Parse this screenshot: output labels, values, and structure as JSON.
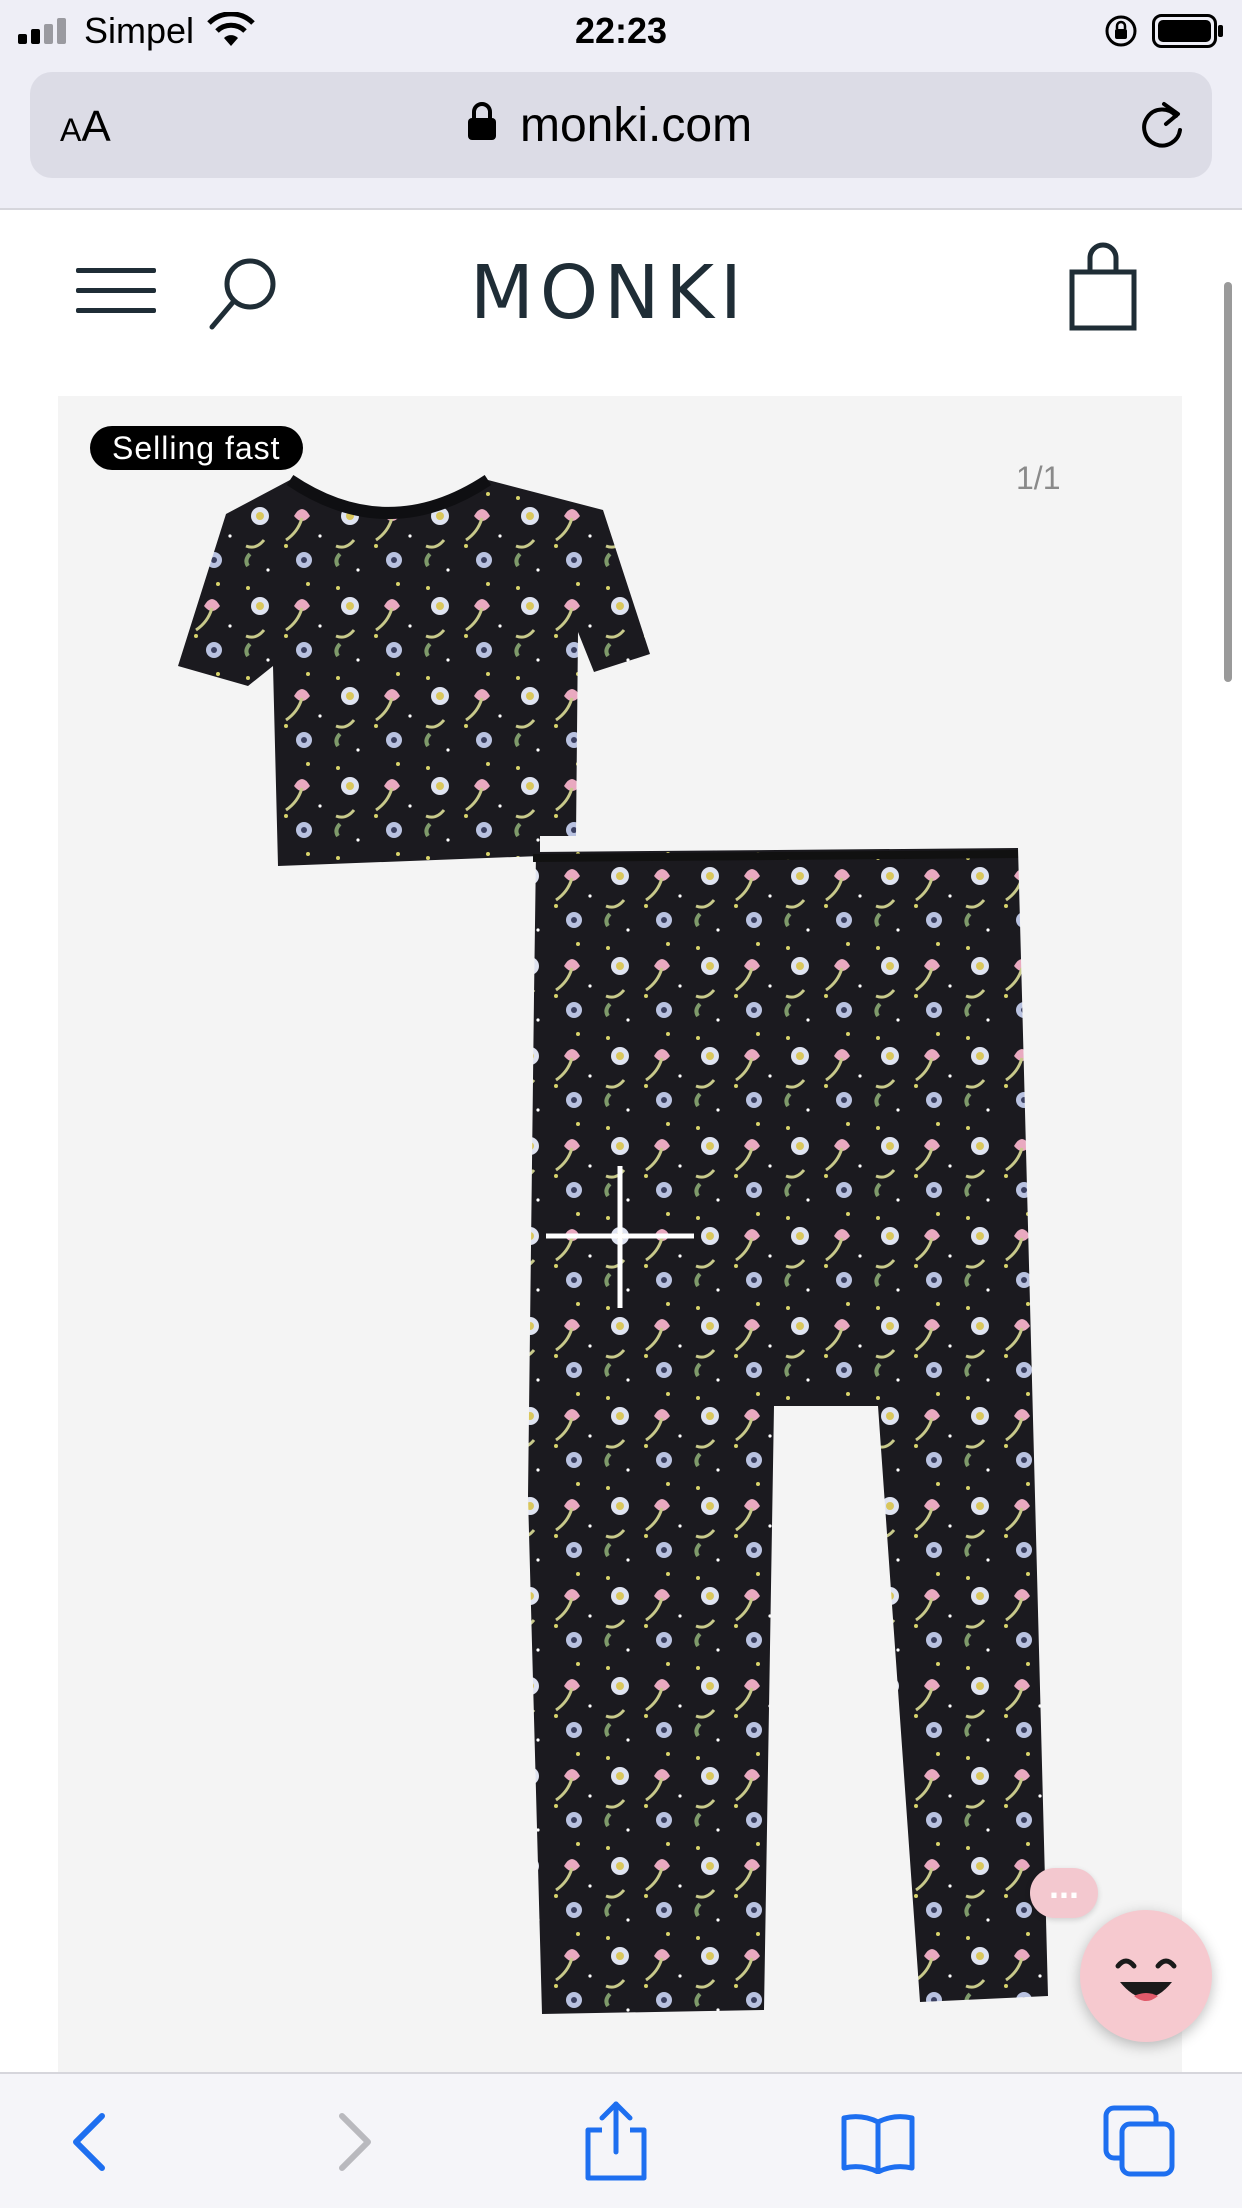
{
  "status_bar": {
    "carrier": "Simpel",
    "time": "22:23",
    "icons": [
      "signal-icon",
      "wifi-icon",
      "orientation-lock-icon",
      "battery-icon"
    ]
  },
  "browser": {
    "text_size_label_small": "A",
    "text_size_label_large": "A",
    "url": "monki.com",
    "icons": [
      "lock-icon",
      "reload-icon"
    ]
  },
  "site_header": {
    "logo": "MONKI",
    "icons": [
      "menu-icon",
      "search-icon",
      "shopping-bag-icon"
    ]
  },
  "product_gallery": {
    "badge": "Selling fast",
    "counter": "1/1",
    "image_description_icon": "pyjama-set-image",
    "colors": {
      "fabric": "#1b1a1f",
      "pink": "#e9a9c0",
      "daisy": "#dfe3f0",
      "leaf": "#c8c98a"
    }
  },
  "chat_widget": {
    "dots": "...",
    "icons": [
      "chat-dots-icon",
      "smiley-chat-icon"
    ]
  },
  "bottom_toolbar": {
    "icons": [
      "back-icon",
      "forward-icon",
      "share-icon",
      "bookmarks-icon",
      "tabs-icon"
    ]
  }
}
